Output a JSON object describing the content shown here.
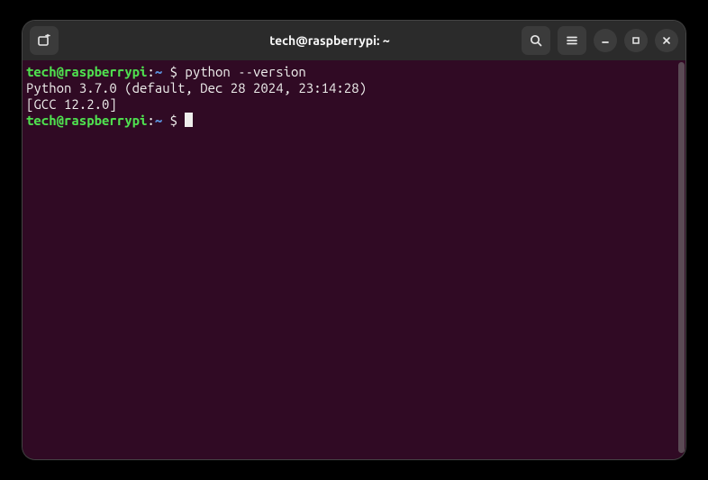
{
  "window": {
    "title": "tech@raspberrypi: ~"
  },
  "prompt": {
    "user_host": "tech@raspberrypi",
    "sep1": ":",
    "path": "~",
    "sep2": " $ "
  },
  "lines": {
    "cmd1": "python --version",
    "out1": "Python 3.7.0 (default, Dec 28 2024, 23:14:28)",
    "out2": "[GCC 12.2.0]"
  }
}
